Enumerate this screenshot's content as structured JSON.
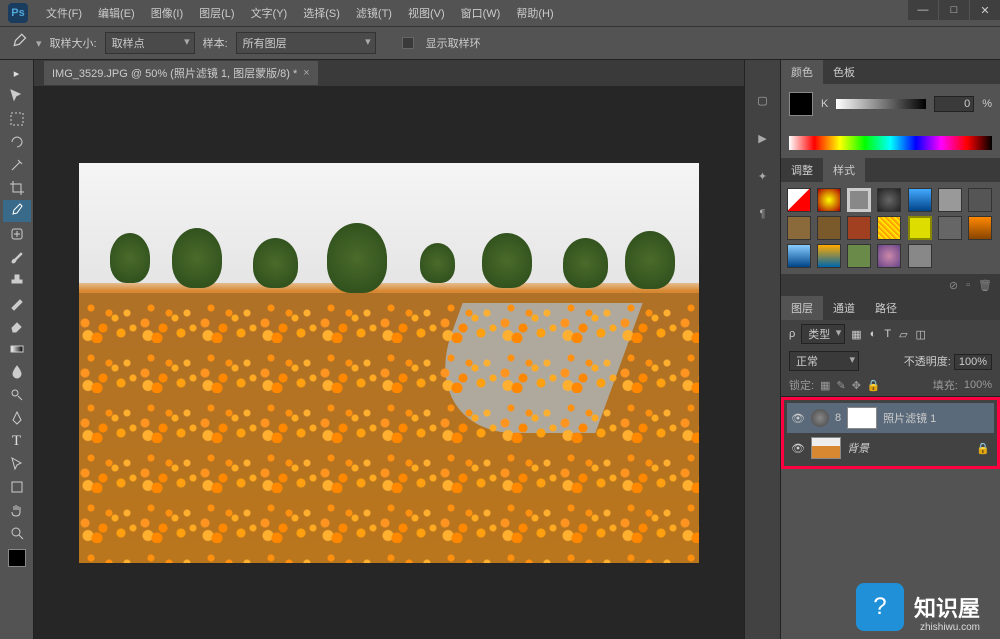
{
  "app": {
    "logo": "Ps"
  },
  "menu": [
    "文件(F)",
    "编辑(E)",
    "图像(I)",
    "图层(L)",
    "文字(Y)",
    "选择(S)",
    "滤镜(T)",
    "视图(V)",
    "窗口(W)",
    "帮助(H)"
  ],
  "optbar": {
    "sample_size_label": "取样大小:",
    "sample_size_value": "取样点",
    "sample_label": "样本:",
    "sample_value": "所有图层",
    "show_ring": "显示取样环"
  },
  "doc": {
    "tab": "IMG_3529.JPG @ 50% (照片滤镜 1, 图层蒙版/8) *"
  },
  "panels": {
    "color": {
      "tab_color": "颜色",
      "tab_swatches": "色板",
      "k": "K",
      "k_val": "0",
      "pct": "%"
    },
    "adjust": {
      "tab_adjust": "调整",
      "tab_styles": "样式"
    },
    "layers": {
      "tab_layers": "图层",
      "tab_channels": "通道",
      "tab_paths": "路径",
      "kind": "类型",
      "blend": "正常",
      "opacity_label": "不透明度:",
      "opacity_val": "100%",
      "lock_label": "锁定:",
      "fill_label": "填充:",
      "fill_val": "100%",
      "layer1": "照片滤镜 1",
      "layer2": "背景"
    }
  },
  "watermark": {
    "text": "知识屋",
    "url": "zhishiwu.com"
  }
}
